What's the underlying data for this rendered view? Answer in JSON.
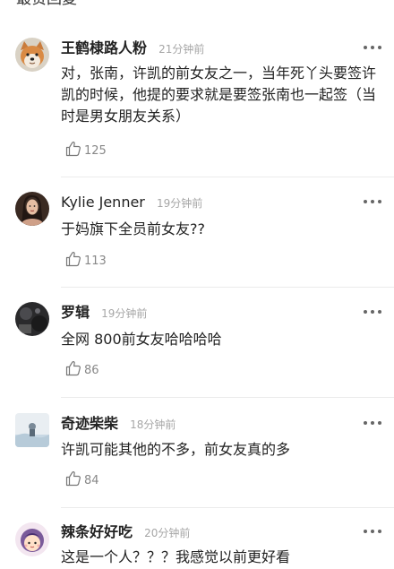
{
  "section": {
    "title": "最赞回复"
  },
  "comments": [
    {
      "username": "王鹤棣路人粉",
      "time": "21分钟前",
      "text": "对，张南，许凯的前女友之一，当年死丫头要签许凯的时候，他提的要求就是要签张南也一起签（当时是男女朋友关系）",
      "likes": "125",
      "avatar_icon": "shiba-dog-avatar"
    },
    {
      "username": "Kylie Jenner",
      "time": "19分钟前",
      "text": "于妈旗下全员前女友??",
      "likes": "113",
      "avatar_icon": "woman-portrait-avatar"
    },
    {
      "username": "罗辑",
      "time": "19分钟前",
      "text": "全网 800前女友哈哈哈哈",
      "likes": "86",
      "avatar_icon": "dark-photo-avatar"
    },
    {
      "username": "奇迹柴柴",
      "time": "18分钟前",
      "text": "许凯可能其他的不多，前女友真的多",
      "likes": "84",
      "avatar_icon": "landscape-avatar"
    },
    {
      "username": "辣条好好吃",
      "time": "20分钟前",
      "text": "这是一个人？？？我感觉以前更好看",
      "likes": "",
      "avatar_icon": "cartoon-girl-avatar"
    }
  ],
  "colors": {
    "text": "#222222",
    "meta": "#a6a6a6",
    "divider": "#ebebeb"
  }
}
